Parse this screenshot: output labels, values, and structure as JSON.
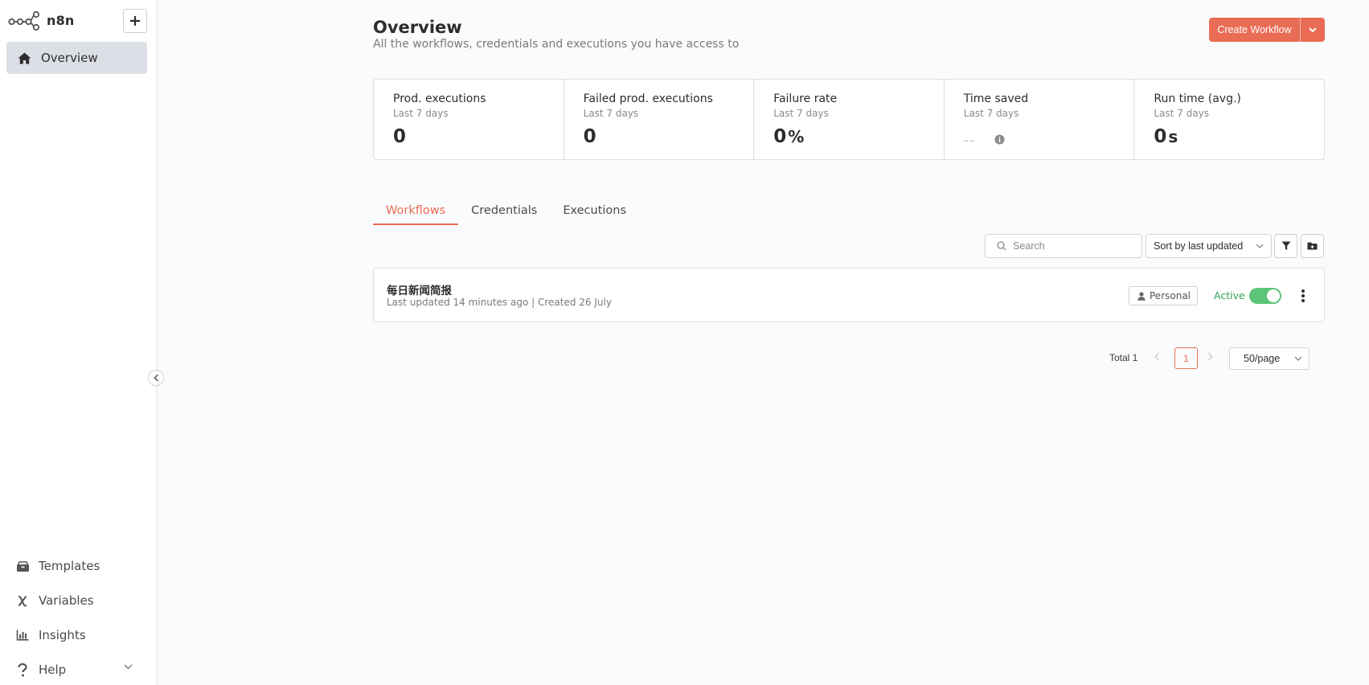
{
  "sidebar": {
    "brand_name": "n8n",
    "nav": [
      {
        "label": "Overview",
        "icon": "home-icon"
      }
    ],
    "bottom_nav": [
      {
        "label": "Templates",
        "icon": "templates-box-icon"
      },
      {
        "label": "Variables",
        "icon": "variable-icon"
      },
      {
        "label": "Insights",
        "icon": "bar-chart-icon"
      },
      {
        "label": "Help",
        "icon": "question-icon"
      }
    ]
  },
  "header": {
    "title": "Overview",
    "subtitle": "All the workflows, credentials and executions you have access to",
    "create_label": "Create Workflow"
  },
  "stats": [
    {
      "title": "Prod. executions",
      "period": "Last 7 days",
      "value": "0",
      "unit": ""
    },
    {
      "title": "Failed prod. executions",
      "period": "Last 7 days",
      "value": "0",
      "unit": ""
    },
    {
      "title": "Failure rate",
      "period": "Last 7 days",
      "value": "0",
      "unit": "%"
    },
    {
      "title": "Time saved",
      "period": "Last 7 days",
      "value": "--",
      "unit": ""
    },
    {
      "title": "Run time (avg.)",
      "period": "Last 7 days",
      "value": "0",
      "unit": "s"
    }
  ],
  "tabs": [
    {
      "label": "Workflows",
      "active": true
    },
    {
      "label": "Credentials",
      "active": false
    },
    {
      "label": "Executions",
      "active": false
    }
  ],
  "toolbar": {
    "search_placeholder": "Search",
    "sort_label": "Sort by last updated"
  },
  "workflows": [
    {
      "name": "每日新闻简报",
      "meta": "Last updated 14 minutes ago | Created 26 July",
      "owner_badge": "Personal",
      "status_label": "Active",
      "active": true
    }
  ],
  "pagination": {
    "total_label": "Total 1",
    "current_page": "1",
    "per_page": "50/page"
  },
  "colors": {
    "accent": "#ea6c55",
    "active_green": "#5cc57a",
    "active_text": "#2fa159",
    "nav_active_bg": "#dcdfe6"
  }
}
